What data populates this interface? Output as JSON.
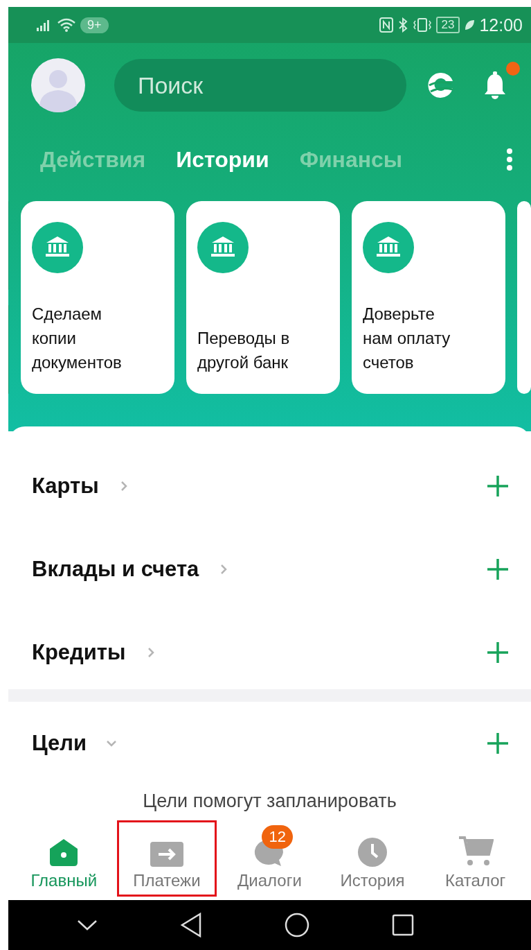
{
  "status_bar": {
    "badge": "9+",
    "battery": "23",
    "time": "12:00"
  },
  "search": {
    "placeholder": "Поиск"
  },
  "notifications": {
    "unread": true
  },
  "tabs": [
    {
      "label": "Действия",
      "selected": false
    },
    {
      "label": "Истории",
      "selected": true
    },
    {
      "label": "Финансы",
      "selected": false
    }
  ],
  "stories": [
    {
      "title": "Сделаем копии документов"
    },
    {
      "title": "Переводы в другой банк"
    },
    {
      "title": "Доверьте нам оплату счетов"
    }
  ],
  "sections": [
    {
      "title": "Карты",
      "expanded": false
    },
    {
      "title": "Вклады и счета",
      "expanded": false
    },
    {
      "title": "Кредиты",
      "expanded": false
    },
    {
      "title": "Цели",
      "expanded": true
    }
  ],
  "goals_hint": "Цели помогут запланировать",
  "bottom_nav": [
    {
      "label": "Главный",
      "selected": true,
      "highlighted": false
    },
    {
      "label": "Платежи",
      "selected": false,
      "highlighted": true
    },
    {
      "label": "Диалоги",
      "selected": false,
      "highlighted": false,
      "badge": "12"
    },
    {
      "label": "История",
      "selected": false,
      "highlighted": false
    },
    {
      "label": "Каталог",
      "selected": false,
      "highlighted": false
    }
  ]
}
